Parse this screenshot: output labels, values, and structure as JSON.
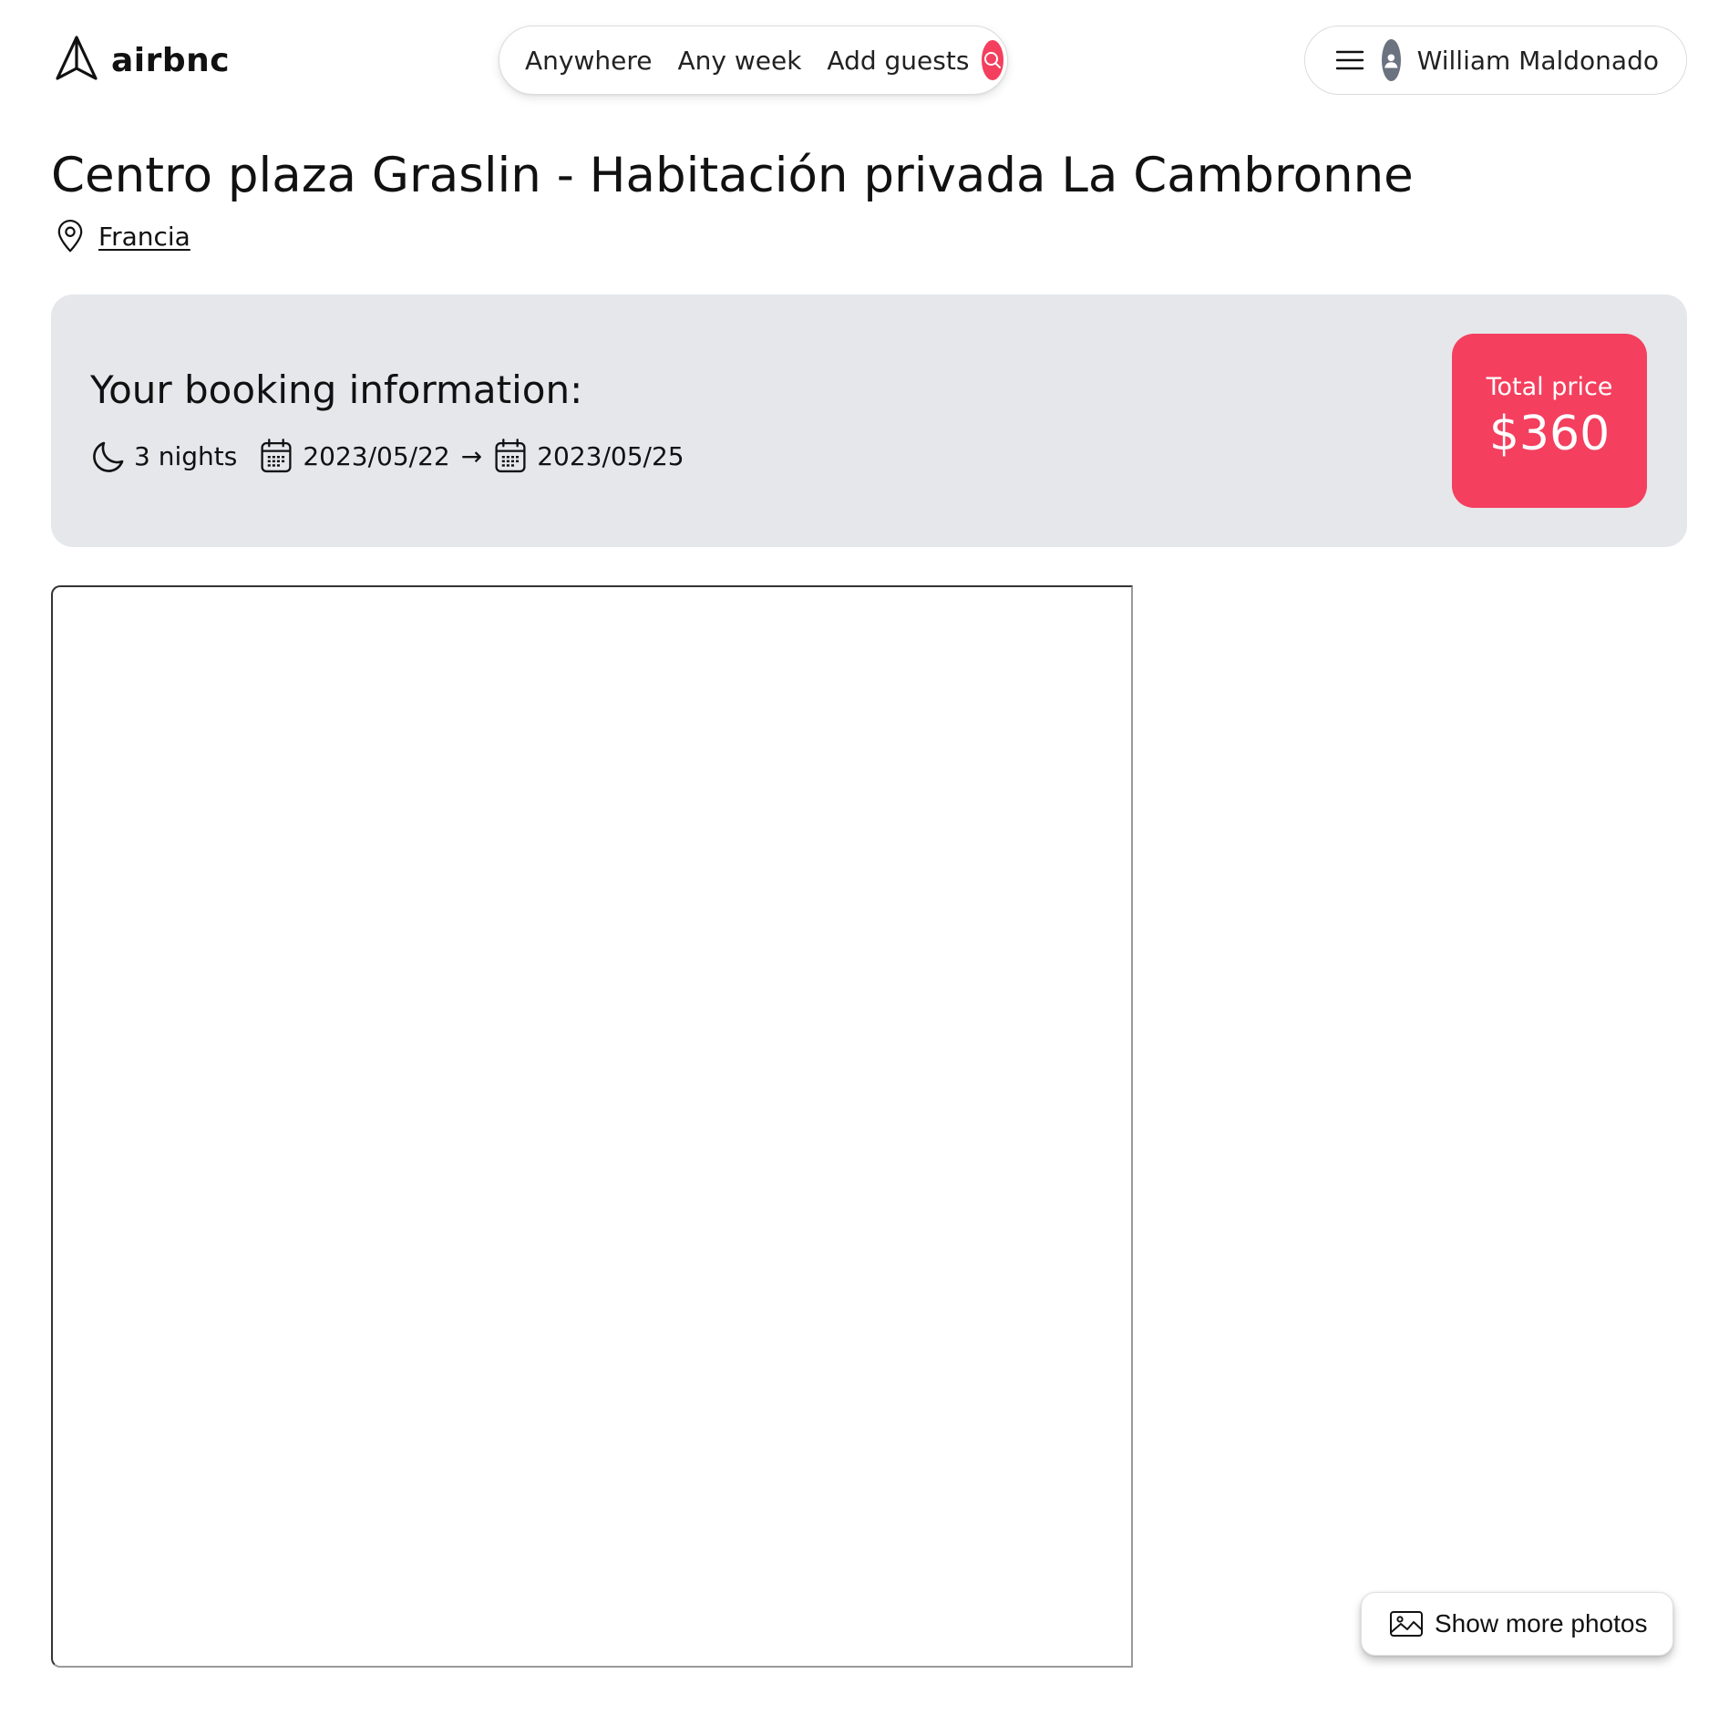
{
  "brand": {
    "name": "airbnc",
    "icon": "paper-plane-icon"
  },
  "search": {
    "location": "Anywhere",
    "week": "Any week",
    "guests": "Add guests",
    "icon": "search-icon"
  },
  "user_menu": {
    "menu_icon": "hamburger-menu-icon",
    "avatar_icon": "user-avatar-icon",
    "name": "William Maldonado"
  },
  "listing": {
    "title": "Centro plaza Graslin - Habitación privada La Cambronne",
    "location_icon": "map-pin-icon",
    "location": "Francia"
  },
  "booking": {
    "heading": "Your booking information:",
    "nights_icon": "moon-icon",
    "nights": "3 nights",
    "calendar_icon": "calendar-icon",
    "check_in": "2023/05/22",
    "arrow": "→",
    "check_out": "2023/05/25",
    "total_label": "Total price",
    "total_value": "$360"
  },
  "photos": {
    "show_more_icon": "image-icon",
    "show_more_label": "Show more photos"
  },
  "colors": {
    "accent": "#f43f5e",
    "booking_bg": "#e5e7eb",
    "avatar_bg": "#6b7280",
    "text": "#111111"
  }
}
